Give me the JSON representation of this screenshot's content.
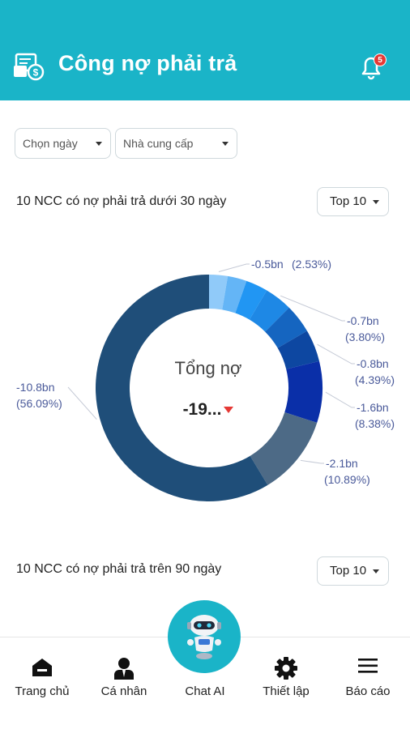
{
  "header": {
    "title": "Công nợ phải trả",
    "notification_count": "5",
    "app_icon": "invoice-money-icon",
    "bell_icon": "bell-icon"
  },
  "filters": {
    "date_label": "Chọn ngày",
    "supplier_label": "Nhà cung cấp"
  },
  "section1": {
    "title": "10 NCC có nợ phải trả dưới 30 ngày",
    "top_label": "Top 10"
  },
  "section2": {
    "title": "10 NCC có nợ phải trả trên 90 ngày",
    "top_label": "Top 10"
  },
  "chart_data": {
    "type": "pie",
    "variant": "donut",
    "center_title": "Tổng nợ",
    "center_value": "-19...",
    "series": [
      {
        "value": -0.5,
        "percent": 2.53,
        "value_label": "-0.5bn",
        "percent_label": "(2.53%)",
        "color": "#90caf9"
      },
      {
        "value": -0.5,
        "percent": 2.6,
        "value_label": "",
        "percent_label": "",
        "color": "#64b5f6"
      },
      {
        "value": -0.6,
        "percent": 3.0,
        "value_label": "",
        "percent_label": "",
        "color": "#2196f3"
      },
      {
        "value": -0.7,
        "percent": 3.8,
        "value_label": "-0.7bn",
        "percent_label": "(3.80%)",
        "color": "#1e88e5"
      },
      {
        "value": -0.75,
        "percent": 3.95,
        "value_label": "",
        "percent_label": "",
        "color": "#1565c0"
      },
      {
        "value": -0.8,
        "percent": 4.39,
        "value_label": "-0.8bn",
        "percent_label": "(4.39%)",
        "color": "#0d47a1"
      },
      {
        "value": -1.6,
        "percent": 8.38,
        "value_label": "-1.6bn",
        "percent_label": "(8.38%)",
        "color": "#0a2fa8"
      },
      {
        "value": -2.1,
        "percent": 10.89,
        "value_label": "-2.1bn",
        "percent_label": "(10.89%)",
        "color": "#4d6a86"
      },
      {
        "value": -10.8,
        "percent": 56.09,
        "value_label": "-10.8bn",
        "percent_label": "(56.09%)",
        "color": "#1f4e79"
      }
    ]
  },
  "fab": {
    "icon": "robot-icon"
  },
  "bottom_nav": [
    {
      "label": "Trang chủ",
      "icon": "home-icon"
    },
    {
      "label": "Cá nhân",
      "icon": "person-icon"
    },
    {
      "label": "Chat AI",
      "icon": "robot-icon"
    },
    {
      "label": "Thiết lập",
      "icon": "gear-icon"
    },
    {
      "label": "Báo cáo",
      "icon": "menu-icon"
    }
  ]
}
